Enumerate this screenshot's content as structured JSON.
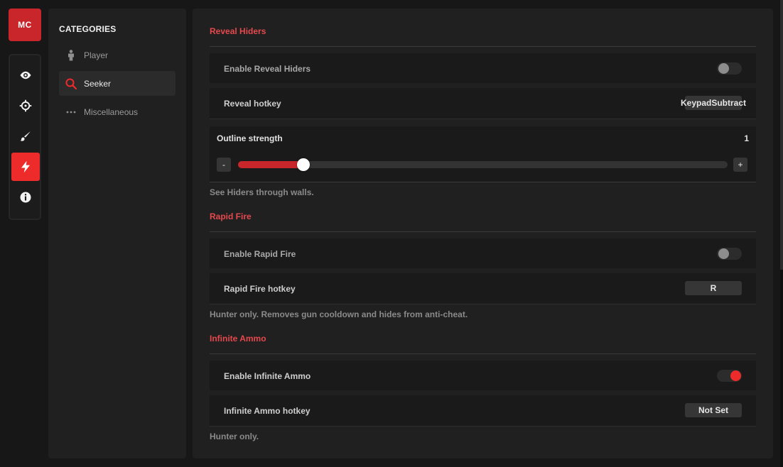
{
  "app": {
    "logo_text": "MC",
    "accent": "#e5484d",
    "logo_color": "#c8262b"
  },
  "rail": {
    "items": [
      {
        "icon": "eye-icon",
        "active": false
      },
      {
        "icon": "crosshair-icon",
        "active": false
      },
      {
        "icon": "brush-icon",
        "active": false
      },
      {
        "icon": "bolt-icon",
        "active": true
      },
      {
        "icon": "info-icon",
        "active": false
      }
    ]
  },
  "categories": {
    "title": "CATEGORIES",
    "items": [
      {
        "label": "Player",
        "icon": "person-icon",
        "active": false
      },
      {
        "label": "Seeker",
        "icon": "search-icon",
        "active": true
      },
      {
        "label": "Miscellaneous",
        "icon": "more-dots-icon",
        "active": false
      }
    ]
  },
  "main": {
    "sections": [
      {
        "title": "Reveal Hiders",
        "toggle_label": "Enable Reveal Hiders",
        "toggle_on": false,
        "hotkey_label": "Reveal hotkey",
        "hotkey_value": "KeypadSubtract",
        "slider": {
          "label": "Outline strength",
          "value": "1",
          "fraction": 0.134,
          "minus": "-",
          "plus": "+"
        },
        "description": "See Hiders through walls."
      },
      {
        "title": "Rapid Fire",
        "toggle_label": "Enable Rapid Fire",
        "toggle_on": false,
        "hotkey_label": "Rapid Fire hotkey",
        "hotkey_value": "R",
        "description": "Hunter only. Removes gun cooldown and hides from anti-cheat."
      },
      {
        "title": "Infinite Ammo",
        "toggle_label": "Enable Infinite Ammo",
        "toggle_on": true,
        "hotkey_label": "Infinite Ammo hotkey",
        "hotkey_value": "Not Set",
        "description": "Hunter only."
      }
    ]
  }
}
